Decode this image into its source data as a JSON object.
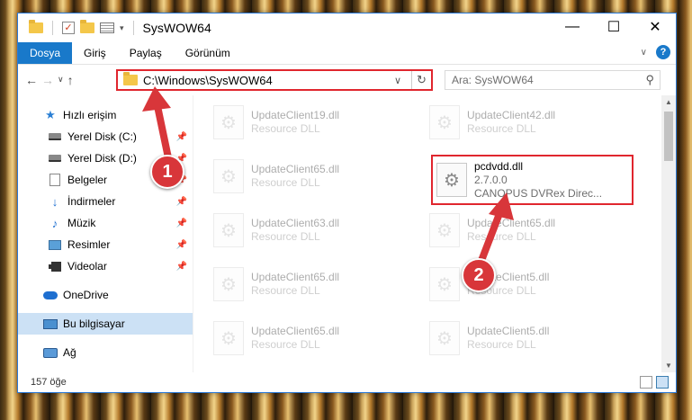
{
  "window": {
    "title": "SysWOW64",
    "controls": {
      "minimize": "—",
      "maximize": "☐",
      "close": "✕"
    }
  },
  "ribbon": {
    "tabs": [
      "Dosya",
      "Giriş",
      "Paylaş",
      "Görünüm"
    ],
    "active_tab": "Dosya",
    "help": "?"
  },
  "address": {
    "path": "C:\\Windows\\SysWOW64",
    "search_placeholder": "Ara: SysWOW64"
  },
  "sidebar": {
    "items": [
      {
        "label": "Hızlı erişim",
        "icon": "star-icon",
        "pinned": false
      },
      {
        "label": "Yerel Disk (C:)",
        "icon": "drive-icon",
        "pinned": true
      },
      {
        "label": "Yerel Disk (D:)",
        "icon": "drive-icon",
        "pinned": true
      },
      {
        "label": "Belgeler",
        "icon": "document-icon",
        "pinned": true
      },
      {
        "label": "İndirmeler",
        "icon": "download-icon",
        "pinned": true
      },
      {
        "label": "Müzik",
        "icon": "music-icon",
        "pinned": true
      },
      {
        "label": "Resimler",
        "icon": "pictures-icon",
        "pinned": true
      },
      {
        "label": "Videolar",
        "icon": "videos-icon",
        "pinned": true
      },
      {
        "label": "OneDrive",
        "icon": "cloud-icon",
        "pinned": false
      },
      {
        "label": "Bu bilgisayar",
        "icon": "computer-icon",
        "pinned": false,
        "selected": true
      },
      {
        "label": "Ağ",
        "icon": "network-icon",
        "pinned": false
      }
    ]
  },
  "files": [
    {
      "name": "UpdateClient19.dll",
      "desc": "Resource DLL",
      "faded": true
    },
    {
      "name": "UpdateClient42.dll",
      "desc": "Resource DLL",
      "faded": true
    },
    {
      "name": "UpdateClient65.dll",
      "desc": "Resource DLL",
      "faded": true
    },
    {
      "name": "pcdvdd.dll",
      "version": "2.7.0.0",
      "desc": "CANOPUS DVRex Direc...",
      "faded": false,
      "highlight": true
    },
    {
      "name": "UpdateClient63.dll",
      "desc": "Resource DLL",
      "faded": true
    },
    {
      "name": "UpdateClient65.dll",
      "desc": "Resource DLL",
      "faded": true
    },
    {
      "name": "UpdateClient65.dll",
      "desc": "Resource DLL",
      "faded": true
    },
    {
      "name": "UpdateClient5.dll",
      "desc": "Resource DLL",
      "faded": true
    },
    {
      "name": "UpdateClient65.dll",
      "desc": "Resource DLL",
      "faded": true
    },
    {
      "name": "UpdateClient5.dll",
      "desc": "Resource DLL",
      "faded": true
    }
  ],
  "status": {
    "count": "157 öğe"
  },
  "annotations": {
    "badge1": "1",
    "badge2": "2",
    "color": "#d8363a"
  }
}
